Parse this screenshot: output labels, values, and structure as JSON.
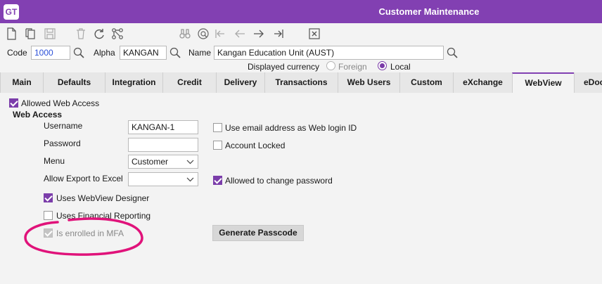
{
  "app": {
    "logo_text": "GT",
    "title": "Customer Maintenance",
    "brand_color": "#8240b2",
    "annotation_color": "#e0127a"
  },
  "toolbar": {
    "icons": [
      "new-document-icon",
      "copy-icon",
      "save-icon",
      "delete-icon",
      "refresh-icon",
      "hierarchy-icon",
      "binoculars-icon",
      "find-icon",
      "first-icon",
      "previous-icon",
      "next-icon",
      "last-icon",
      "close-window-icon"
    ]
  },
  "header": {
    "code_label": "Code",
    "code_value": "1000",
    "alpha_label": "Alpha",
    "alpha_value": "KANGAN",
    "name_label": "Name",
    "name_value": "Kangan Education Unit (AUST)",
    "currency_label": "Displayed currency",
    "currency_options": [
      "Foreign",
      "Local"
    ],
    "currency_selected": "Local"
  },
  "tabs": [
    "Main",
    "Defaults",
    "Integration",
    "Credit",
    "Delivery",
    "Transactions",
    "Web Users",
    "Custom",
    "eXchange",
    "WebView",
    "eDoc"
  ],
  "active_tab": "WebView",
  "webview": {
    "allowed_web_access_label": "Allowed Web Access",
    "allowed_web_access": true,
    "section_title": "Web Access",
    "username_label": "Username",
    "username_value": "KANGAN-1",
    "password_label": "Password",
    "password_value": "",
    "menu_label": "Menu",
    "menu_value": "Customer",
    "export_label": "Allow Export to Excel",
    "export_value": "",
    "use_email_label": "Use email address as Web login ID",
    "use_email": false,
    "account_locked_label": "Account Locked",
    "account_locked": false,
    "change_password_label": "Allowed to change password",
    "change_password": true,
    "webview_designer_label": "Uses WebView Designer",
    "webview_designer": true,
    "financial_reporting_label": "Uses Financial Reporting",
    "financial_reporting": false,
    "mfa_label": "Is enrolled in MFA",
    "mfa": true,
    "generate_button": "Generate Passcode"
  }
}
